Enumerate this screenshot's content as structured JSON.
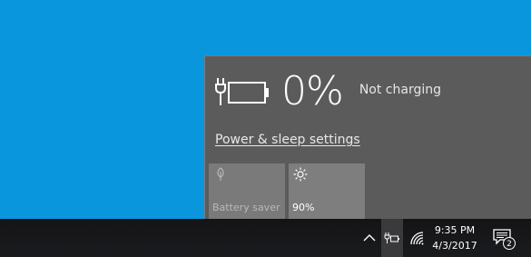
{
  "battery_flyout": {
    "percent": "0%",
    "status": "Not charging",
    "settings_link": "Power & sleep settings",
    "tiles": [
      {
        "label": "Battery saver",
        "icon": "leaf-icon",
        "state": "off"
      },
      {
        "label": "90%",
        "icon": "brightness-icon",
        "state": "on"
      }
    ],
    "battery_level": 0
  },
  "taskbar": {
    "time": "9:35 PM",
    "date": "4/3/2017",
    "notification_count": "2",
    "tray_icons": [
      "chevron-up-icon",
      "battery-icon",
      "wifi-icon",
      "action-center-icon"
    ]
  },
  "colors": {
    "desktop": "#0a96dc",
    "flyout_bg": "#5b5b5b",
    "tile_off": "#7a7a7a",
    "taskbar": "#1a1b1e"
  }
}
